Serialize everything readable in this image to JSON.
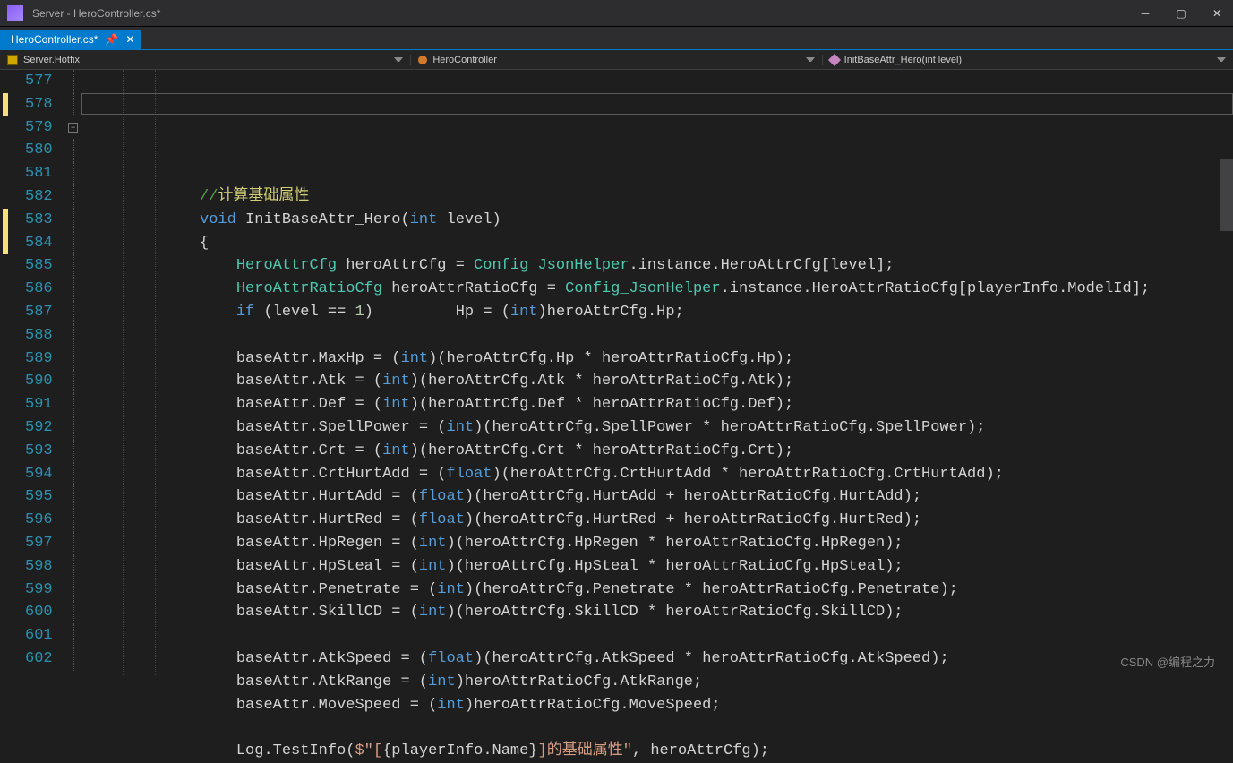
{
  "window": {
    "title": "Server - HeroController.cs*"
  },
  "tab": {
    "label": "HeroController.cs*"
  },
  "context": {
    "namespace": "Server.Hotfix",
    "class": "HeroController",
    "method": "InitBaseAttr_Hero(int level)"
  },
  "line_start": 577,
  "lines": [
    {
      "n": 577,
      "indent": 3,
      "segs": []
    },
    {
      "n": 578,
      "indent": 3,
      "bookmark": true,
      "highlight_box": true,
      "segs": [
        {
          "t": "//",
          "c": "cmt"
        },
        {
          "t": "计算基础属性",
          "c": "cmt-cn"
        }
      ]
    },
    {
      "n": 579,
      "indent": 3,
      "fold_box": true,
      "segs": [
        {
          "t": "void ",
          "c": "kw"
        },
        {
          "t": "InitBaseAttr_Hero",
          "c": "id"
        },
        {
          "t": "(",
          "c": "pn"
        },
        {
          "t": "int ",
          "c": "kw"
        },
        {
          "t": "level",
          "c": "id"
        },
        {
          "t": ")",
          "c": "pn"
        }
      ]
    },
    {
      "n": 580,
      "indent": 3,
      "segs": [
        {
          "t": "{",
          "c": "pn"
        }
      ]
    },
    {
      "n": 581,
      "indent": 4,
      "segs": [
        {
          "t": "HeroAttrCfg ",
          "c": "type"
        },
        {
          "t": "heroAttrCfg ",
          "c": "id"
        },
        {
          "t": "= ",
          "c": "pn"
        },
        {
          "t": "Config_JsonHelper",
          "c": "type"
        },
        {
          "t": ".",
          "c": "pn"
        },
        {
          "t": "instance",
          "c": "id"
        },
        {
          "t": ".",
          "c": "pn"
        },
        {
          "t": "HeroAttrCfg",
          "c": "id"
        },
        {
          "t": "[",
          "c": "pn"
        },
        {
          "t": "level",
          "c": "id"
        },
        {
          "t": "]",
          "c": "pn"
        },
        {
          "t": ";",
          "c": "pn"
        }
      ]
    },
    {
      "n": 582,
      "indent": 4,
      "segs": [
        {
          "t": "HeroAttrRatioCfg ",
          "c": "type"
        },
        {
          "t": "heroAttrRatioCfg ",
          "c": "id"
        },
        {
          "t": "= ",
          "c": "pn"
        },
        {
          "t": "Config_JsonHelper",
          "c": "type"
        },
        {
          "t": ".",
          "c": "pn"
        },
        {
          "t": "instance",
          "c": "id"
        },
        {
          "t": ".",
          "c": "pn"
        },
        {
          "t": "HeroAttrRatioCfg",
          "c": "id"
        },
        {
          "t": "[",
          "c": "pn"
        },
        {
          "t": "playerInfo",
          "c": "id"
        },
        {
          "t": ".",
          "c": "pn"
        },
        {
          "t": "ModelId",
          "c": "id"
        },
        {
          "t": "]",
          "c": "pn"
        },
        {
          "t": ";",
          "c": "pn"
        }
      ]
    },
    {
      "n": 583,
      "indent": 4,
      "bookmark": true,
      "segs": [
        {
          "t": "if ",
          "c": "kw"
        },
        {
          "t": "(",
          "c": "pn"
        },
        {
          "t": "level ",
          "c": "id"
        },
        {
          "t": "== ",
          "c": "pn"
        },
        {
          "t": "1",
          "c": "num"
        },
        {
          "t": ")         ",
          "c": "pn"
        },
        {
          "t": "Hp ",
          "c": "id"
        },
        {
          "t": "= (",
          "c": "pn"
        },
        {
          "t": "int",
          "c": "kw"
        },
        {
          "t": ")",
          "c": "pn"
        },
        {
          "t": "heroAttrCfg",
          "c": "id"
        },
        {
          "t": ".",
          "c": "pn"
        },
        {
          "t": "Hp",
          "c": "id"
        },
        {
          "t": ";",
          "c": "pn"
        }
      ]
    },
    {
      "n": 584,
      "indent": 4,
      "bookmark": true,
      "segs": []
    },
    {
      "n": 585,
      "indent": 4,
      "segs": [
        {
          "t": "baseAttr",
          "c": "id"
        },
        {
          "t": ".",
          "c": "pn"
        },
        {
          "t": "MaxHp ",
          "c": "id"
        },
        {
          "t": "= (",
          "c": "pn"
        },
        {
          "t": "int",
          "c": "kw"
        },
        {
          "t": ")(",
          "c": "pn"
        },
        {
          "t": "heroAttrCfg",
          "c": "id"
        },
        {
          "t": ".",
          "c": "pn"
        },
        {
          "t": "Hp ",
          "c": "id"
        },
        {
          "t": "* ",
          "c": "pn"
        },
        {
          "t": "heroAttrRatioCfg",
          "c": "id"
        },
        {
          "t": ".",
          "c": "pn"
        },
        {
          "t": "Hp",
          "c": "id"
        },
        {
          "t": ");",
          "c": "pn"
        }
      ]
    },
    {
      "n": 586,
      "indent": 4,
      "segs": [
        {
          "t": "baseAttr",
          "c": "id"
        },
        {
          "t": ".",
          "c": "pn"
        },
        {
          "t": "Atk ",
          "c": "id"
        },
        {
          "t": "= (",
          "c": "pn"
        },
        {
          "t": "int",
          "c": "kw"
        },
        {
          "t": ")(",
          "c": "pn"
        },
        {
          "t": "heroAttrCfg",
          "c": "id"
        },
        {
          "t": ".",
          "c": "pn"
        },
        {
          "t": "Atk ",
          "c": "id"
        },
        {
          "t": "* ",
          "c": "pn"
        },
        {
          "t": "heroAttrRatioCfg",
          "c": "id"
        },
        {
          "t": ".",
          "c": "pn"
        },
        {
          "t": "Atk",
          "c": "id"
        },
        {
          "t": ");",
          "c": "pn"
        }
      ]
    },
    {
      "n": 587,
      "indent": 4,
      "segs": [
        {
          "t": "baseAttr",
          "c": "id"
        },
        {
          "t": ".",
          "c": "pn"
        },
        {
          "t": "Def ",
          "c": "id"
        },
        {
          "t": "= (",
          "c": "pn"
        },
        {
          "t": "int",
          "c": "kw"
        },
        {
          "t": ")(",
          "c": "pn"
        },
        {
          "t": "heroAttrCfg",
          "c": "id"
        },
        {
          "t": ".",
          "c": "pn"
        },
        {
          "t": "Def ",
          "c": "id"
        },
        {
          "t": "* ",
          "c": "pn"
        },
        {
          "t": "heroAttrRatioCfg",
          "c": "id"
        },
        {
          "t": ".",
          "c": "pn"
        },
        {
          "t": "Def",
          "c": "id"
        },
        {
          "t": ");",
          "c": "pn"
        }
      ]
    },
    {
      "n": 588,
      "indent": 4,
      "segs": [
        {
          "t": "baseAttr",
          "c": "id"
        },
        {
          "t": ".",
          "c": "pn"
        },
        {
          "t": "SpellPower ",
          "c": "id"
        },
        {
          "t": "= (",
          "c": "pn"
        },
        {
          "t": "int",
          "c": "kw"
        },
        {
          "t": ")(",
          "c": "pn"
        },
        {
          "t": "heroAttrCfg",
          "c": "id"
        },
        {
          "t": ".",
          "c": "pn"
        },
        {
          "t": "SpellPower ",
          "c": "id"
        },
        {
          "t": "* ",
          "c": "pn"
        },
        {
          "t": "heroAttrRatioCfg",
          "c": "id"
        },
        {
          "t": ".",
          "c": "pn"
        },
        {
          "t": "SpellPower",
          "c": "id"
        },
        {
          "t": ");",
          "c": "pn"
        }
      ]
    },
    {
      "n": 589,
      "indent": 4,
      "segs": [
        {
          "t": "baseAttr",
          "c": "id"
        },
        {
          "t": ".",
          "c": "pn"
        },
        {
          "t": "Crt ",
          "c": "id"
        },
        {
          "t": "= (",
          "c": "pn"
        },
        {
          "t": "int",
          "c": "kw"
        },
        {
          "t": ")(",
          "c": "pn"
        },
        {
          "t": "heroAttrCfg",
          "c": "id"
        },
        {
          "t": ".",
          "c": "pn"
        },
        {
          "t": "Crt ",
          "c": "id"
        },
        {
          "t": "* ",
          "c": "pn"
        },
        {
          "t": "heroAttrRatioCfg",
          "c": "id"
        },
        {
          "t": ".",
          "c": "pn"
        },
        {
          "t": "Crt",
          "c": "id"
        },
        {
          "t": ");",
          "c": "pn"
        }
      ]
    },
    {
      "n": 590,
      "indent": 4,
      "segs": [
        {
          "t": "baseAttr",
          "c": "id"
        },
        {
          "t": ".",
          "c": "pn"
        },
        {
          "t": "CrtHurtAdd ",
          "c": "id"
        },
        {
          "t": "= (",
          "c": "pn"
        },
        {
          "t": "float",
          "c": "kw"
        },
        {
          "t": ")(",
          "c": "pn"
        },
        {
          "t": "heroAttrCfg",
          "c": "id"
        },
        {
          "t": ".",
          "c": "pn"
        },
        {
          "t": "CrtHurtAdd ",
          "c": "id"
        },
        {
          "t": "* ",
          "c": "pn"
        },
        {
          "t": "heroAttrRatioCfg",
          "c": "id"
        },
        {
          "t": ".",
          "c": "pn"
        },
        {
          "t": "CrtHurtAdd",
          "c": "id"
        },
        {
          "t": ");",
          "c": "pn"
        }
      ]
    },
    {
      "n": 591,
      "indent": 4,
      "segs": [
        {
          "t": "baseAttr",
          "c": "id"
        },
        {
          "t": ".",
          "c": "pn"
        },
        {
          "t": "HurtAdd ",
          "c": "id"
        },
        {
          "t": "= (",
          "c": "pn"
        },
        {
          "t": "float",
          "c": "kw"
        },
        {
          "t": ")(",
          "c": "pn"
        },
        {
          "t": "heroAttrCfg",
          "c": "id"
        },
        {
          "t": ".",
          "c": "pn"
        },
        {
          "t": "HurtAdd ",
          "c": "id"
        },
        {
          "t": "+ ",
          "c": "pn"
        },
        {
          "t": "heroAttrRatioCfg",
          "c": "id"
        },
        {
          "t": ".",
          "c": "pn"
        },
        {
          "t": "HurtAdd",
          "c": "id"
        },
        {
          "t": ");",
          "c": "pn"
        }
      ]
    },
    {
      "n": 592,
      "indent": 4,
      "segs": [
        {
          "t": "baseAttr",
          "c": "id"
        },
        {
          "t": ".",
          "c": "pn"
        },
        {
          "t": "HurtRed ",
          "c": "id"
        },
        {
          "t": "= (",
          "c": "pn"
        },
        {
          "t": "float",
          "c": "kw"
        },
        {
          "t": ")(",
          "c": "pn"
        },
        {
          "t": "heroAttrCfg",
          "c": "id"
        },
        {
          "t": ".",
          "c": "pn"
        },
        {
          "t": "HurtRed ",
          "c": "id"
        },
        {
          "t": "+ ",
          "c": "pn"
        },
        {
          "t": "heroAttrRatioCfg",
          "c": "id"
        },
        {
          "t": ".",
          "c": "pn"
        },
        {
          "t": "HurtRed",
          "c": "id"
        },
        {
          "t": ");",
          "c": "pn"
        }
      ]
    },
    {
      "n": 593,
      "indent": 4,
      "segs": [
        {
          "t": "baseAttr",
          "c": "id"
        },
        {
          "t": ".",
          "c": "pn"
        },
        {
          "t": "HpRegen ",
          "c": "id"
        },
        {
          "t": "= (",
          "c": "pn"
        },
        {
          "t": "int",
          "c": "kw"
        },
        {
          "t": ")(",
          "c": "pn"
        },
        {
          "t": "heroAttrCfg",
          "c": "id"
        },
        {
          "t": ".",
          "c": "pn"
        },
        {
          "t": "HpRegen ",
          "c": "id"
        },
        {
          "t": "* ",
          "c": "pn"
        },
        {
          "t": "heroAttrRatioCfg",
          "c": "id"
        },
        {
          "t": ".",
          "c": "pn"
        },
        {
          "t": "HpRegen",
          "c": "id"
        },
        {
          "t": ");",
          "c": "pn"
        }
      ]
    },
    {
      "n": 594,
      "indent": 4,
      "segs": [
        {
          "t": "baseAttr",
          "c": "id"
        },
        {
          "t": ".",
          "c": "pn"
        },
        {
          "t": "HpSteal ",
          "c": "id"
        },
        {
          "t": "= (",
          "c": "pn"
        },
        {
          "t": "int",
          "c": "kw"
        },
        {
          "t": ")(",
          "c": "pn"
        },
        {
          "t": "heroAttrCfg",
          "c": "id"
        },
        {
          "t": ".",
          "c": "pn"
        },
        {
          "t": "HpSteal ",
          "c": "id"
        },
        {
          "t": "* ",
          "c": "pn"
        },
        {
          "t": "heroAttrRatioCfg",
          "c": "id"
        },
        {
          "t": ".",
          "c": "pn"
        },
        {
          "t": "HpSteal",
          "c": "id"
        },
        {
          "t": ");",
          "c": "pn"
        }
      ]
    },
    {
      "n": 595,
      "indent": 4,
      "segs": [
        {
          "t": "baseAttr",
          "c": "id"
        },
        {
          "t": ".",
          "c": "pn"
        },
        {
          "t": "Penetrate ",
          "c": "id"
        },
        {
          "t": "= (",
          "c": "pn"
        },
        {
          "t": "int",
          "c": "kw"
        },
        {
          "t": ")(",
          "c": "pn"
        },
        {
          "t": "heroAttrCfg",
          "c": "id"
        },
        {
          "t": ".",
          "c": "pn"
        },
        {
          "t": "Penetrate ",
          "c": "id"
        },
        {
          "t": "* ",
          "c": "pn"
        },
        {
          "t": "heroAttrRatioCfg",
          "c": "id"
        },
        {
          "t": ".",
          "c": "pn"
        },
        {
          "t": "Penetrate",
          "c": "id"
        },
        {
          "t": ");",
          "c": "pn"
        }
      ]
    },
    {
      "n": 596,
      "indent": 4,
      "segs": [
        {
          "t": "baseAttr",
          "c": "id"
        },
        {
          "t": ".",
          "c": "pn"
        },
        {
          "t": "SkillCD ",
          "c": "id"
        },
        {
          "t": "= (",
          "c": "pn"
        },
        {
          "t": "int",
          "c": "kw"
        },
        {
          "t": ")(",
          "c": "pn"
        },
        {
          "t": "heroAttrCfg",
          "c": "id"
        },
        {
          "t": ".",
          "c": "pn"
        },
        {
          "t": "SkillCD ",
          "c": "id"
        },
        {
          "t": "* ",
          "c": "pn"
        },
        {
          "t": "heroAttrRatioCfg",
          "c": "id"
        },
        {
          "t": ".",
          "c": "pn"
        },
        {
          "t": "SkillCD",
          "c": "id"
        },
        {
          "t": ");",
          "c": "pn"
        }
      ]
    },
    {
      "n": 597,
      "indent": 4,
      "segs": []
    },
    {
      "n": 598,
      "indent": 4,
      "segs": [
        {
          "t": "baseAttr",
          "c": "id"
        },
        {
          "t": ".",
          "c": "pn"
        },
        {
          "t": "AtkSpeed ",
          "c": "id"
        },
        {
          "t": "= (",
          "c": "pn"
        },
        {
          "t": "float",
          "c": "kw"
        },
        {
          "t": ")(",
          "c": "pn"
        },
        {
          "t": "heroAttrCfg",
          "c": "id"
        },
        {
          "t": ".",
          "c": "pn"
        },
        {
          "t": "AtkSpeed ",
          "c": "id"
        },
        {
          "t": "* ",
          "c": "pn"
        },
        {
          "t": "heroAttrRatioCfg",
          "c": "id"
        },
        {
          "t": ".",
          "c": "pn"
        },
        {
          "t": "AtkSpeed",
          "c": "id"
        },
        {
          "t": ");",
          "c": "pn"
        }
      ]
    },
    {
      "n": 599,
      "indent": 4,
      "segs": [
        {
          "t": "baseAttr",
          "c": "id"
        },
        {
          "t": ".",
          "c": "pn"
        },
        {
          "t": "AtkRange ",
          "c": "id"
        },
        {
          "t": "= (",
          "c": "pn"
        },
        {
          "t": "int",
          "c": "kw"
        },
        {
          "t": ")",
          "c": "pn"
        },
        {
          "t": "heroAttrRatioCfg",
          "c": "id"
        },
        {
          "t": ".",
          "c": "pn"
        },
        {
          "t": "AtkRange",
          "c": "id"
        },
        {
          "t": ";",
          "c": "pn"
        }
      ]
    },
    {
      "n": 600,
      "indent": 4,
      "segs": [
        {
          "t": "baseAttr",
          "c": "id"
        },
        {
          "t": ".",
          "c": "pn"
        },
        {
          "t": "MoveSpeed ",
          "c": "id"
        },
        {
          "t": "= (",
          "c": "pn"
        },
        {
          "t": "int",
          "c": "kw"
        },
        {
          "t": ")",
          "c": "pn"
        },
        {
          "t": "heroAttrRatioCfg",
          "c": "id"
        },
        {
          "t": ".",
          "c": "pn"
        },
        {
          "t": "MoveSpeed",
          "c": "id"
        },
        {
          "t": ";",
          "c": "pn"
        }
      ]
    },
    {
      "n": 601,
      "indent": 4,
      "segs": []
    },
    {
      "n": 602,
      "indent": 4,
      "segs": [
        {
          "t": "Log",
          "c": "id"
        },
        {
          "t": ".",
          "c": "pn"
        },
        {
          "t": "TestInfo",
          "c": "id"
        },
        {
          "t": "(",
          "c": "pn"
        },
        {
          "t": "$\"[",
          "c": "str"
        },
        {
          "t": "{",
          "c": "pn"
        },
        {
          "t": "playerInfo",
          "c": "id"
        },
        {
          "t": ".",
          "c": "pn"
        },
        {
          "t": "Name",
          "c": "id"
        },
        {
          "t": "}",
          "c": "pn"
        },
        {
          "t": "]的基础属性\"",
          "c": "str"
        },
        {
          "t": ", ",
          "c": "pn"
        },
        {
          "t": "heroAttrCfg",
          "c": "id"
        },
        {
          "t": ");",
          "c": "pn"
        }
      ]
    }
  ],
  "watermark": "CSDN @编程之力"
}
